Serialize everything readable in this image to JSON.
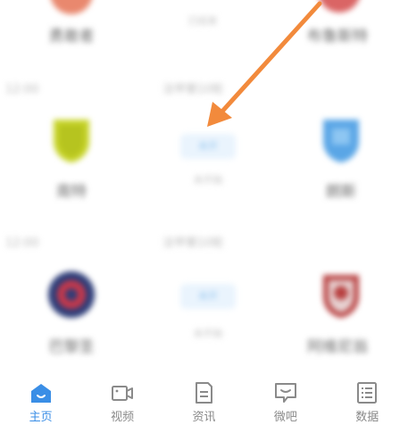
{
  "matches": [
    {
      "header_left": "",
      "header_center": "",
      "home": {
        "name": "勇敢者",
        "logo_color": "#e46a4a",
        "logo": "top-partial-logo"
      },
      "score_label": "",
      "status": "已结束",
      "away": {
        "name": "布鲁斯特",
        "logo_color": "#d44a4a",
        "logo": "top-partial-logo"
      }
    },
    {
      "header_left": "12:00",
      "header_center": "法甲第10轮",
      "home": {
        "name": "南特",
        "logo_color": "#c7d427",
        "logo": "shield-logo"
      },
      "score_label": "未开",
      "status": "未开始",
      "away": {
        "name": "朗斯",
        "logo_color": "#5aa6e6",
        "logo": "shield-logo"
      }
    },
    {
      "header_left": "12:00",
      "header_center": "法甲第10轮",
      "home": {
        "name": "巴黎圣",
        "logo_color": "#2e3d78",
        "logo": "round-logo"
      },
      "score_label": "未开",
      "status": "未开始",
      "away": {
        "name": "阿维尼翁",
        "logo_color": "#b84040",
        "logo": "shield-logo"
      }
    }
  ],
  "arrow": {
    "color": "#f28a3c",
    "icon": "annotation-arrow-icon"
  },
  "tabbar": {
    "active_color": "#3a8ee6",
    "inactive_color": "#8a8a8a",
    "tabs": [
      {
        "label": "主页",
        "icon": "home-icon"
      },
      {
        "label": "视频",
        "icon": "video-camera-icon"
      },
      {
        "label": "资讯",
        "icon": "news-document-icon"
      },
      {
        "label": "微吧",
        "icon": "chat-bubble-icon"
      },
      {
        "label": "数据",
        "icon": "data-list-icon"
      }
    ]
  }
}
